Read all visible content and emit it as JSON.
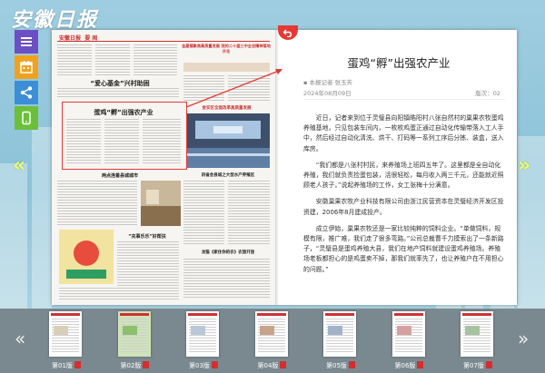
{
  "logo": "安徽日报",
  "sidebar": [
    {
      "icon": "menu-icon"
    },
    {
      "icon": "calendar-icon"
    },
    {
      "icon": "share-icon"
    },
    {
      "icon": "mobile-icon"
    }
  ],
  "nav": {
    "prev_icon": "double-chevron-left-icon",
    "next_icon": "double-chevron-right-icon"
  },
  "newspaper": {
    "masthead": "安徽日报",
    "section": "要 闻",
    "headlines": {
      "top_right": "金星镇聚焦高质量发展 党的二十届三中全会精神落地开花",
      "love_fund": "“爱心基金”兴村助困",
      "egg": "蛋鸡“孵”出强农产业",
      "reform": "金安区全面改革高质量发展",
      "bottom_left": "两点连着县城城市",
      "promote": "“充事乐乐”好帮扶",
      "bottom_mid": "四省会县城之大型水产养殖区",
      "bottom_right": "龙猫《家住你的农》农旅开放"
    }
  },
  "article": {
    "title": "蛋鸡“孵”出强农产业",
    "reporter": "本报记者 张玉芳",
    "date": "2024年08月09日",
    "version": "版次：02",
    "paragraphs": [
      "近日，记者来到位于灵璧县向阳镇皓阳村八张自然村的巢果农牧蛋鸡养殖基地，只见包装车间内，一枚枚鸡蛋正通过自动化传输带落入工人手中，然后经过自动化清洗、烘干、打码等一系列工序后分拣、装盒，送入库房。",
      "“我们都是八张村村民，来养殖场上班四五年了。这里都是全自动化养殖，我们就负责捡蛋包装，活很轻松，每月收入两三千元，还能就近照顾老人孩子。”说起养殖场的工作，女工张梅十分满意。",
      "安徽巢果农牧产业科技有限公司由浙江民营资本在灵璧经济开发区投资建，2006年8月建成投产。",
      "成立伊始，巢果农牧还是一家比较纯粹的饲料企业。“单做饲料，规模有限，推广难，我们走了很多弯路。”公司总裁曹千力摸索出了一条新路子，“灵璧县是蛋鸡养殖大县，我们在地产饲料就建设蛋鸡养殖场。养殖场老板都担心的是鸡蛋卖不掉，那我们就率先了，也让养殖户在不用担心的问题。”"
    ]
  },
  "thumbnails": [
    {
      "label": "第01版"
    },
    {
      "label": "第02版",
      "active": true
    },
    {
      "label": "第03版"
    },
    {
      "label": "第04版"
    },
    {
      "label": "第05版"
    },
    {
      "label": "第06版"
    },
    {
      "label": "第07版"
    }
  ],
  "colors": {
    "accent": "#e53935",
    "side_arrow": "#e8ff6a"
  }
}
